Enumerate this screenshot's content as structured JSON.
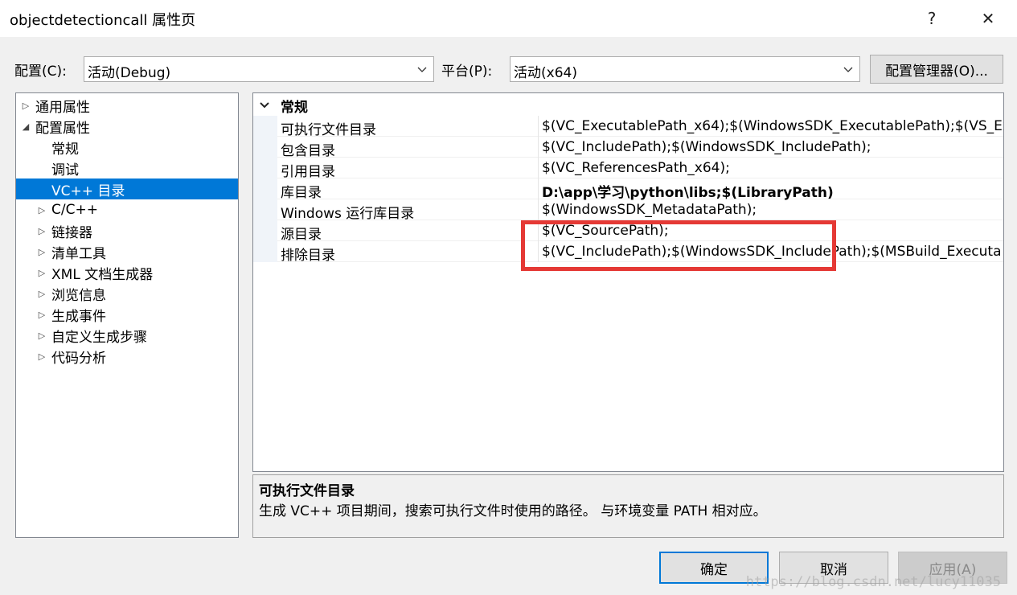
{
  "window": {
    "title": "objectdetectioncall 属性页",
    "help_glyph": "?",
    "close_glyph": "✕"
  },
  "toolbar": {
    "config_label": "配置(C):",
    "config_value": "活动(Debug)",
    "platform_label": "平台(P):",
    "platform_value": "活动(x64)",
    "config_manager_label": "配置管理器(O)..."
  },
  "tree": {
    "items": [
      {
        "label": "通用属性"
      },
      {
        "label": "配置属性"
      },
      {
        "label": "常规"
      },
      {
        "label": "调试"
      },
      {
        "label": "VC++ 目录"
      },
      {
        "label": "C/C++"
      },
      {
        "label": "链接器"
      },
      {
        "label": "清单工具"
      },
      {
        "label": "XML 文档生成器"
      },
      {
        "label": "浏览信息"
      },
      {
        "label": "生成事件"
      },
      {
        "label": "自定义生成步骤"
      },
      {
        "label": "代码分析"
      }
    ]
  },
  "grid": {
    "category": "常规",
    "rows": [
      {
        "name": "可执行文件目录",
        "value": "$(VC_ExecutablePath_x64);$(WindowsSDK_ExecutablePath);$(VS_Ex"
      },
      {
        "name": "包含目录",
        "value": "$(VC_IncludePath);$(WindowsSDK_IncludePath);"
      },
      {
        "name": "引用目录",
        "value": "$(VC_ReferencesPath_x64);"
      },
      {
        "name": "库目录",
        "value": "D:\\app\\学习\\python\\libs;$(LibraryPath)"
      },
      {
        "name": "Windows 运行库目录",
        "value": "$(WindowsSDK_MetadataPath);"
      },
      {
        "name": "源目录",
        "value": "$(VC_SourcePath);"
      },
      {
        "name": "排除目录",
        "value": "$(VC_IncludePath);$(WindowsSDK_IncludePath);$(MSBuild_Executa"
      }
    ]
  },
  "description": {
    "title": "可执行文件目录",
    "text": "生成 VC++ 项目期间，搜索可执行文件时使用的路径。 与环境变量 PATH 相对应。"
  },
  "buttons": {
    "ok": "确定",
    "cancel": "取消",
    "apply": "应用(A)"
  },
  "watermark": "https://blog.csdn.net/lucy11035",
  "colors": {
    "selection": "#0078d7",
    "highlight_box": "#e53935"
  }
}
